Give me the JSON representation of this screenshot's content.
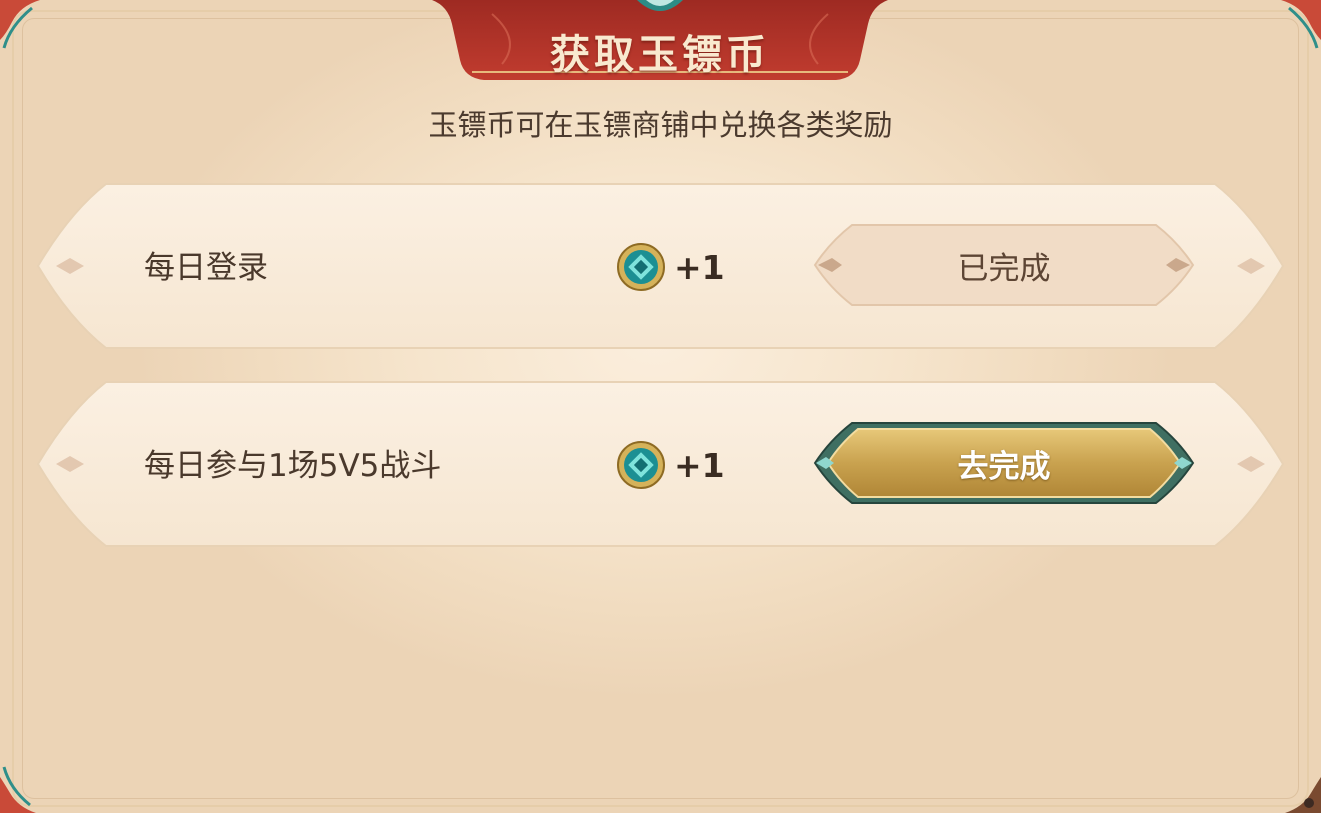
{
  "dialog": {
    "title": "获取玉镖币",
    "subtitle": "玉镖币可在玉镖商铺中兑换各类奖励"
  },
  "tasks": [
    {
      "label": "每日登录",
      "reward_amount": "+1",
      "reward_icon": "jade-coin-icon",
      "button_label": "已完成",
      "status": "completed"
    },
    {
      "label": "每日参与1场5V5战斗",
      "reward_amount": "+1",
      "reward_icon": "jade-coin-icon",
      "button_label": "去完成",
      "status": "pending"
    }
  ],
  "colors": {
    "banner_red": "#b5342b",
    "gold_button": "#c9a24f",
    "jade": "#2fb3b0",
    "panel_bg": "#f6e5cd"
  }
}
